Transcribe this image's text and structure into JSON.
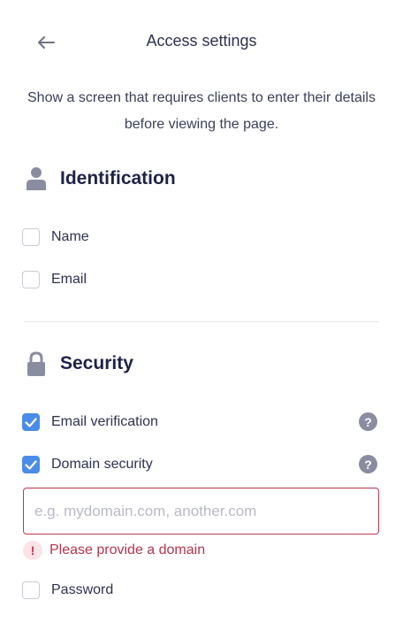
{
  "header": {
    "back_icon": "arrow-left-icon",
    "title": "Access settings"
  },
  "description": "Show a screen that requires clients to enter their details before viewing the page.",
  "identification": {
    "icon": "user-icon",
    "title": "Identification",
    "options": [
      {
        "label": "Name",
        "checked": false
      },
      {
        "label": "Email",
        "checked": false
      }
    ]
  },
  "security": {
    "icon": "lock-icon",
    "title": "Security",
    "email_verification": {
      "label": "Email verification",
      "checked": true,
      "help_icon": "question-circle-icon"
    },
    "domain_security": {
      "label": "Domain security",
      "checked": true,
      "help_icon": "question-circle-icon"
    },
    "domain_input": {
      "placeholder": "e.g. mydomain.com, another.com",
      "value": ""
    },
    "error": {
      "icon": "exclamation-icon",
      "text": "Please provide a domain"
    },
    "password": {
      "label": "Password",
      "checked": false
    }
  },
  "colors": {
    "accent": "#4a8ce8",
    "error": "#c0364f",
    "heading": "#1f2246",
    "icon_gray": "#8a8d9f"
  }
}
